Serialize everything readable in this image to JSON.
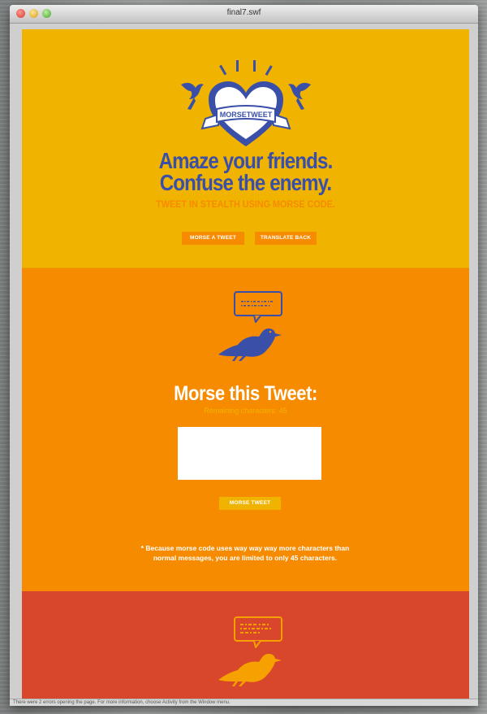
{
  "window": {
    "title": "final7.swf"
  },
  "hero": {
    "logo_text": "MORSETWEET",
    "headline_line1": "Amaze your friends.",
    "headline_line2": "Confuse the enemy.",
    "subheadline": "TWEET IN STEALTH USING MORSE CODE.",
    "button_morse": "MORSE A TWEET",
    "button_translate": "TRANSLATE BACK"
  },
  "morse_section": {
    "title": "Morse this Tweet:",
    "remaining_label": "Remaining characters: 45",
    "input_value": "",
    "submit_label": "MORSE TWEET",
    "note_line1": "* Because morse code uses way way way more characters than",
    "note_line2": "normal messages, you are limited to only 45 characters."
  },
  "status": {
    "message": "There were 2 errors opening the page. For more information, choose Activity from the Window menu."
  },
  "icons": {
    "logo": "heart-banner-icon",
    "birds": "swallow-icon",
    "pigeon": "pigeon-icon",
    "speech": "speech-bubble-icon"
  },
  "colors": {
    "yellow": "#f0b300",
    "orange": "#f78b00",
    "red": "#d8462b",
    "blue": "#3a4fa8"
  }
}
